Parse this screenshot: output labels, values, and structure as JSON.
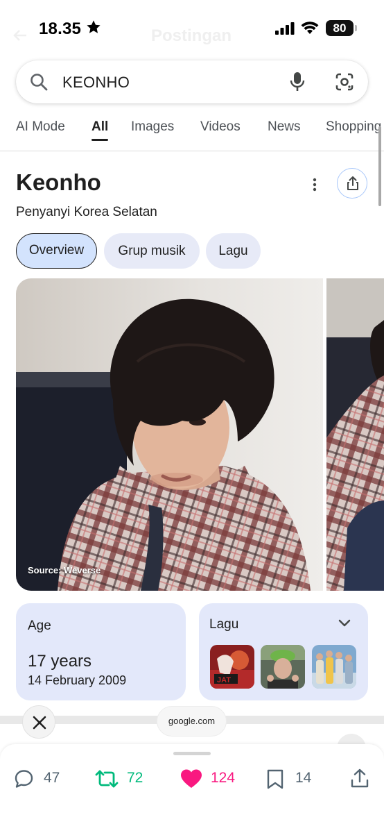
{
  "status_bar": {
    "time": "18.35",
    "battery": "80",
    "faded_title": "Postingan"
  },
  "search": {
    "query": "KEONHO",
    "icons": [
      "search-icon",
      "microphone-icon",
      "google-lens-icon"
    ]
  },
  "tabs": [
    {
      "label": "AI Mode",
      "active": false
    },
    {
      "label": "All",
      "active": true
    },
    {
      "label": "Images",
      "active": false
    },
    {
      "label": "Videos",
      "active": false
    },
    {
      "label": "News",
      "active": false
    },
    {
      "label": "Shopping",
      "active": false
    }
  ],
  "entity": {
    "name": "Keonho",
    "description": "Penyanyi Korea Selatan"
  },
  "chips": [
    {
      "label": "Overview",
      "active": true
    },
    {
      "label": "Grup musik",
      "active": false
    },
    {
      "label": "Lagu",
      "active": false
    }
  ],
  "image": {
    "source": "Source: Weverse"
  },
  "age_card": {
    "label": "Age",
    "value": "17 years",
    "birth_date": "14 February 2009"
  },
  "songs_card": {
    "label": "Lagu",
    "thumbnail_count": 3
  },
  "browser": {
    "domain": "google.com"
  },
  "post_actions": {
    "replies": "47",
    "reposts": "72",
    "likes": "124",
    "bookmarks": "14"
  },
  "colors": {
    "accent_blue": "#d3e3fd",
    "card_bg": "#e3e8fa",
    "repost_green": "#00ba7c",
    "like_pink": "#f91880",
    "meta_gray": "#536471"
  }
}
